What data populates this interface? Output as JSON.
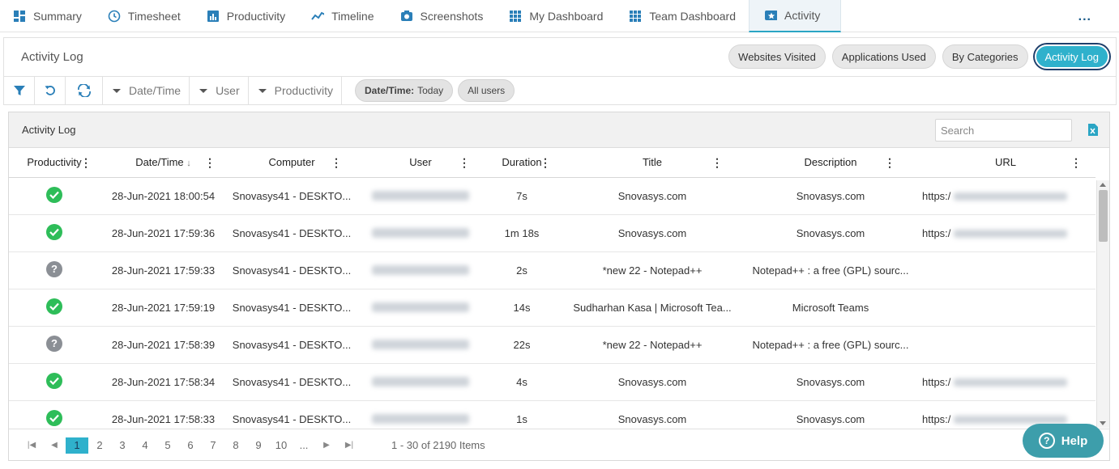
{
  "nav": {
    "tabs": [
      {
        "label": "Summary",
        "icon": "summary-icon"
      },
      {
        "label": "Timesheet",
        "icon": "clock-icon"
      },
      {
        "label": "Productivity",
        "icon": "bar-chart-icon"
      },
      {
        "label": "Timeline",
        "icon": "line-chart-icon"
      },
      {
        "label": "Screenshots",
        "icon": "camera-icon"
      },
      {
        "label": "My Dashboard",
        "icon": "grid-icon"
      },
      {
        "label": "Team Dashboard",
        "icon": "grid-icon"
      },
      {
        "label": "Activity",
        "icon": "star-card-icon"
      }
    ],
    "more": "..."
  },
  "header": {
    "title": "Activity Log",
    "views": [
      "Websites Visited",
      "Applications Used",
      "By Categories",
      "Activity Log"
    ]
  },
  "filters": {
    "dropdowns": [
      "Date/Time",
      "User",
      "Productivity"
    ],
    "chip_date_label": "Date/Time:",
    "chip_date_value": "Today",
    "chip_users": "All users"
  },
  "grid": {
    "title": "Activity Log",
    "search_placeholder": "Search",
    "columns": [
      "Productivity",
      "Date/Time",
      "Computer",
      "User",
      "Duration",
      "Title",
      "Description",
      "URL"
    ],
    "date_sort_arrow": "↓",
    "rows": [
      {
        "status": "ok",
        "datetime": "28-Jun-2021 18:00:54",
        "computer": "Snovasys41 - DESKTO...",
        "duration": "7s",
        "title": "Snovasys.com",
        "description": "Snovasys.com",
        "url": "https:/"
      },
      {
        "status": "ok",
        "datetime": "28-Jun-2021 17:59:36",
        "computer": "Snovasys41 - DESKTO...",
        "duration": "1m 18s",
        "title": "Snovasys.com",
        "description": "Snovasys.com",
        "url": "https:/"
      },
      {
        "status": "unknown",
        "datetime": "28-Jun-2021 17:59:33",
        "computer": "Snovasys41 - DESKTO...",
        "duration": "2s",
        "title": "*new 22 - Notepad++",
        "description": "Notepad++ : a free (GPL) sourc...",
        "url": ""
      },
      {
        "status": "ok",
        "datetime": "28-Jun-2021 17:59:19",
        "computer": "Snovasys41 - DESKTO...",
        "duration": "14s",
        "title": "Sudharhan Kasa | Microsoft Tea...",
        "description": "Microsoft Teams",
        "url": ""
      },
      {
        "status": "unknown",
        "datetime": "28-Jun-2021 17:58:39",
        "computer": "Snovasys41 - DESKTO...",
        "duration": "22s",
        "title": "*new 22 - Notepad++",
        "description": "Notepad++ : a free (GPL) sourc...",
        "url": ""
      },
      {
        "status": "ok",
        "datetime": "28-Jun-2021 17:58:34",
        "computer": "Snovasys41 - DESKTO...",
        "duration": "4s",
        "title": "Snovasys.com",
        "description": "Snovasys.com",
        "url": "https:/"
      },
      {
        "status": "ok",
        "datetime": "28-Jun-2021 17:58:33",
        "computer": "Snovasys41 - DESKTO...",
        "duration": "1s",
        "title": "Snovasys.com",
        "description": "Snovasys.com",
        "url": "https:/"
      }
    ]
  },
  "pager": {
    "pages": [
      "1",
      "2",
      "3",
      "4",
      "5",
      "6",
      "7",
      "8",
      "9",
      "10",
      "..."
    ],
    "current": "1",
    "info": "1 - 30 of 2190 Items"
  },
  "help": {
    "label": "Help"
  },
  "colors": {
    "accent": "#2fb1cc",
    "ok": "#2ebd59",
    "unknown": "#8b8f95",
    "help": "#3d9eab"
  }
}
